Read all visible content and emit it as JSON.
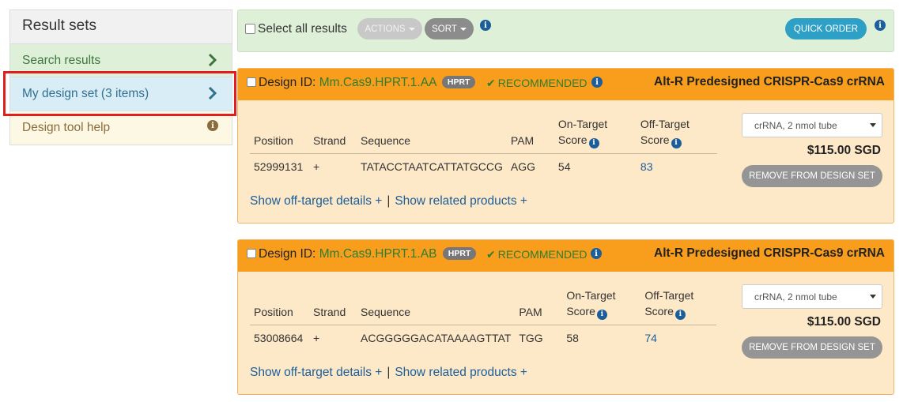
{
  "sidebar": {
    "title": "Result sets",
    "items": [
      {
        "label": "Search results"
      },
      {
        "label": "My design set (3 items)"
      },
      {
        "label": "Design tool help"
      }
    ]
  },
  "toolbar": {
    "select_all_label": "Select all results",
    "actions_label": "ACTIONS",
    "sort_label": "SORT",
    "quick_order_label": "QUICK ORDER"
  },
  "cards": [
    {
      "design_id_prefix": "Design ID:",
      "design_id": "Mm.Cas9.HPRT.1.AA",
      "gene_badge": "HPRT",
      "status": "RECOMMENDED",
      "product": "Alt-R Predesigned CRISPR-Cas9 crRNA",
      "headers": {
        "position": "Position",
        "strand": "Strand",
        "sequence": "Sequence",
        "pam": "PAM",
        "on_target_1": "On-Target",
        "on_target_2": "Score",
        "off_target_1": "Off-Target",
        "off_target_2": "Score"
      },
      "row": {
        "position": "52999131",
        "strand": "+",
        "sequence": "TATACCTAATCATTATGCCG",
        "pam": "AGG",
        "on_target": "54",
        "off_target": "83"
      },
      "show_off_target": "Show off-target details +",
      "separator": "|",
      "show_related": "Show related products +",
      "format_selected": "crRNA, 2 nmol tube",
      "price": "$115.00 SGD",
      "remove_label": "REMOVE FROM DESIGN SET"
    },
    {
      "design_id_prefix": "Design ID:",
      "design_id": "Mm.Cas9.HPRT.1.AB",
      "gene_badge": "HPRT",
      "status": "RECOMMENDED",
      "product": "Alt-R Predesigned CRISPR-Cas9 crRNA",
      "headers": {
        "position": "Position",
        "strand": "Strand",
        "sequence": "Sequence",
        "pam": "PAM",
        "on_target_1": "On-Target",
        "on_target_2": "Score",
        "off_target_1": "Off-Target",
        "off_target_2": "Score"
      },
      "row": {
        "position": "53008664",
        "strand": "+",
        "sequence": "ACGGGGGACATAAAAGTTAT",
        "pam": "TGG",
        "on_target": "58",
        "off_target": "74"
      },
      "show_off_target": "Show off-target details +",
      "separator": "|",
      "show_related": "Show related products +",
      "format_selected": "crRNA, 2 nmol tube",
      "price": "$115.00 SGD",
      "remove_label": "REMOVE FROM DESIGN SET"
    }
  ],
  "icons": {
    "chevron": "chevron-right-icon",
    "info": "info-icon",
    "check": "check-icon",
    "caret": "caret-down-icon"
  },
  "colors": {
    "accent_orange": "#f99d1c",
    "card_bg": "#fde8c7",
    "link_blue": "#1b5e9a",
    "green": "#2e7d32",
    "highlight_red": "#e11d1d"
  }
}
